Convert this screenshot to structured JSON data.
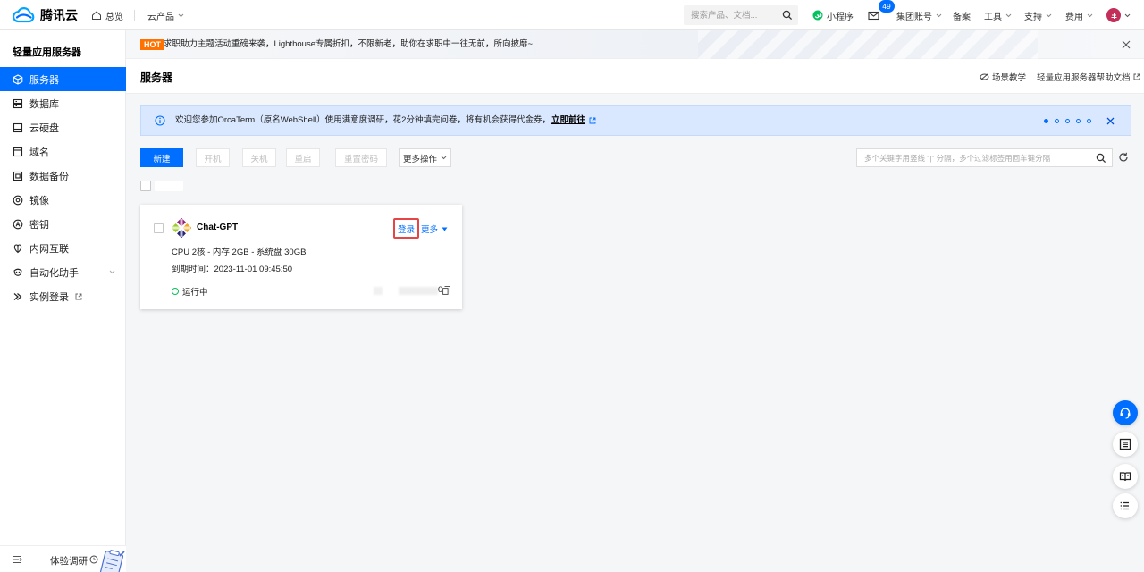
{
  "topbar": {
    "logo_text": "腾讯云",
    "overview_label": "总览",
    "products_label": "云产品",
    "search_placeholder": "搜索产品、文档...",
    "miniprogram_label": "小程序",
    "mail_badge": "49",
    "account_label": "集团账号",
    "beian_label": "备案",
    "tools_label": "工具",
    "support_label": "支持",
    "billing_label": "费用"
  },
  "sidebar": {
    "title": "轻量应用服务器",
    "items": [
      {
        "label": "服务器",
        "icon": "server-icon",
        "selected": true
      },
      {
        "label": "数据库",
        "icon": "database-icon"
      },
      {
        "label": "云硬盘",
        "icon": "disk-icon"
      },
      {
        "label": "域名",
        "icon": "domain-icon"
      },
      {
        "label": "数据备份",
        "icon": "backup-icon"
      },
      {
        "label": "镜像",
        "icon": "image-icon"
      },
      {
        "label": "密钥",
        "icon": "key-icon"
      },
      {
        "label": "内网互联",
        "icon": "network-icon"
      },
      {
        "label": "自动化助手",
        "icon": "automation-icon",
        "has_submenu": true
      },
      {
        "label": "实例登录",
        "icon": "login-icon",
        "external": true
      }
    ],
    "footer_label": "体验调研"
  },
  "promo": {
    "badge": "HOT",
    "text": "求职助力主题活动重磅来袭，Lighthouse专属折扣，不限新老，助你在求职中一往无前，所向披靡~"
  },
  "page": {
    "title": "服务器",
    "scene_link": "场景教学",
    "help_link": "轻量应用服务器帮助文档"
  },
  "notice": {
    "text": "欢迎您参加OrcaTerm（原名WebShell）使用满意度调研，花2分钟填完问卷，将有机会获得代金券，",
    "link": "立即前往",
    "pages": 5,
    "current_page": 1
  },
  "toolbar": {
    "create_label": "新建",
    "start_label": "开机",
    "stop_label": "关机",
    "restart_label": "重启",
    "reset_password_label": "重置密码",
    "more_actions_label": "更多操作",
    "search_placeholder": "多个关键字用竖线 “|” 分隔，多个过滤标签用回车键分隔"
  },
  "instances": [
    {
      "name": "Chat-GPT",
      "login_label": "登录",
      "more_label": "更多",
      "specs": "CPU 2核 - 内存 2GB - 系统盘 30GB",
      "expiry": "到期时间：2023-11-01 09:45:50",
      "status": "运行中",
      "ip_visible": "0"
    }
  ],
  "colors": {
    "accent": "#006eff",
    "hot": "#ff7200",
    "highlight": "#e54545",
    "running": "#0abf5b"
  }
}
